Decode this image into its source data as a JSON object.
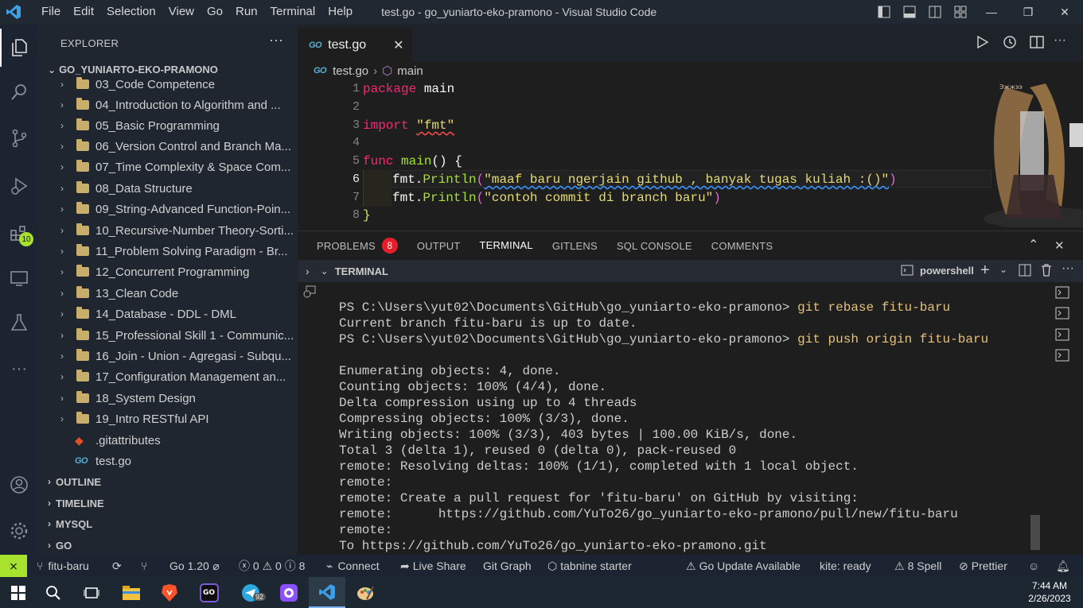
{
  "window": {
    "title": "test.go - go_yuniarto-eko-pramono - Visual Studio Code",
    "menu": [
      "File",
      "Edit",
      "Selection",
      "View",
      "Go",
      "Run",
      "Terminal",
      "Help"
    ]
  },
  "activity": {
    "extensions_badge": "10"
  },
  "sidebar": {
    "header": "EXPLORER",
    "more": "···",
    "root": "GO_YUNIARTO-EKO-PRAMONO",
    "folders": [
      "03_Code Competence",
      "04_Introduction to Algorithm and ...",
      "05_Basic Programming",
      "06_Version Control and Branch Ma...",
      "07_Time Complexity & Space Com...",
      "08_Data Structure",
      "09_String-Advanced Function-Poin...",
      "10_Recursive-Number Theory-Sorti...",
      "11_Problem Solving Paradigm - Br...",
      "12_Concurrent Programming",
      "13_Clean Code",
      "14_Database - DDL - DML",
      "15_Professional Skill 1 - Communic...",
      "16_Join - Union - Agregasi - Subqu...",
      "17_Configuration Management an...",
      "18_System Design",
      "19_Intro RESTful API"
    ],
    "files": [
      ".gitattributes",
      "test.go"
    ],
    "sections": [
      "OUTLINE",
      "TIMELINE",
      "MYSQL",
      "GO"
    ]
  },
  "editor": {
    "tab": "test.go",
    "tab_icon": "GO",
    "breadcrumb_file": "test.go",
    "breadcrumb_symbol": "main",
    "line_numbers": [
      "1",
      "2",
      "3",
      "4",
      "5",
      "6",
      "7",
      "8"
    ],
    "code": {
      "l1_kw": "package",
      "l1_rest": " main",
      "l3_kw": "import",
      "l3_str": "\"fmt\"",
      "l5_kw": "func",
      "l5_fn": "main",
      "l5_rest": "() {",
      "l6_obj": "fmt.",
      "l6_fn": "Println",
      "l6_open": "(",
      "l6_str": "\"maaf baru ngerjain github , banyak tugas kuliah :()\"",
      "l6_close": ")",
      "l7_obj": "fmt.",
      "l7_fn": "Println",
      "l7_open": "(",
      "l7_str": "\"contoh commit di branch baru\"",
      "l7_close": ")",
      "l8": "}"
    }
  },
  "panel": {
    "tabs": [
      "PROBLEMS",
      "OUTPUT",
      "TERMINAL",
      "GITLENS",
      "SQL CONSOLE",
      "COMMENTS"
    ],
    "problems_count": "8",
    "terminal_title": "TERMINAL",
    "shell": "powershell"
  },
  "terminal": {
    "prompt": "PS C:\\Users\\yut02\\Documents\\GitHub\\go_yuniarto-eko-pramono>",
    "cmd1": "git rebase fitu-baru",
    "out1": "Current branch fitu-baru is up to date.",
    "cmd2": "git push origin fitu-baru",
    "lines": [
      "Enumerating objects: 4, done.",
      "Counting objects: 100% (4/4), done.",
      "Delta compression using up to 4 threads",
      "Compressing objects: 100% (3/3), done.",
      "Writing objects: 100% (3/3), 403 bytes | 100.00 KiB/s, done.",
      "Total 3 (delta 1), reused 0 (delta 0), pack-reused 0",
      "remote: Resolving deltas: 100% (1/1), completed with 1 local object.",
      "remote:",
      "remote: Create a pull request for 'fitu-baru' on GitHub by visiting:",
      "remote:      https://github.com/YuTo26/go_yuniarto-eko-pramono/pull/new/fitu-baru",
      "remote:",
      "To https://github.com/YuTo26/go_yuniarto-eko-pramono.git"
    ]
  },
  "statusbar": {
    "branch": "fitu-baru",
    "go_version": "Go 1.20",
    "errors": "0",
    "warnings": "0",
    "info": "8",
    "connect": "Connect",
    "live_share": "Live Share",
    "git_graph": "Git Graph",
    "tabnine": "tabnine starter",
    "go_update": "Go Update Available",
    "kite": "kite: ready",
    "spell": "8 Spell",
    "prettier": "Prettier"
  },
  "taskbar": {
    "time": "7:44 AM",
    "date": "2/26/2023",
    "telegram_badge": "92"
  },
  "colors": {
    "keyword": "#f92672",
    "function": "#a6e22e",
    "string": "#e6db74",
    "accent": "#a6e22e",
    "badge": "#e51e2a"
  }
}
